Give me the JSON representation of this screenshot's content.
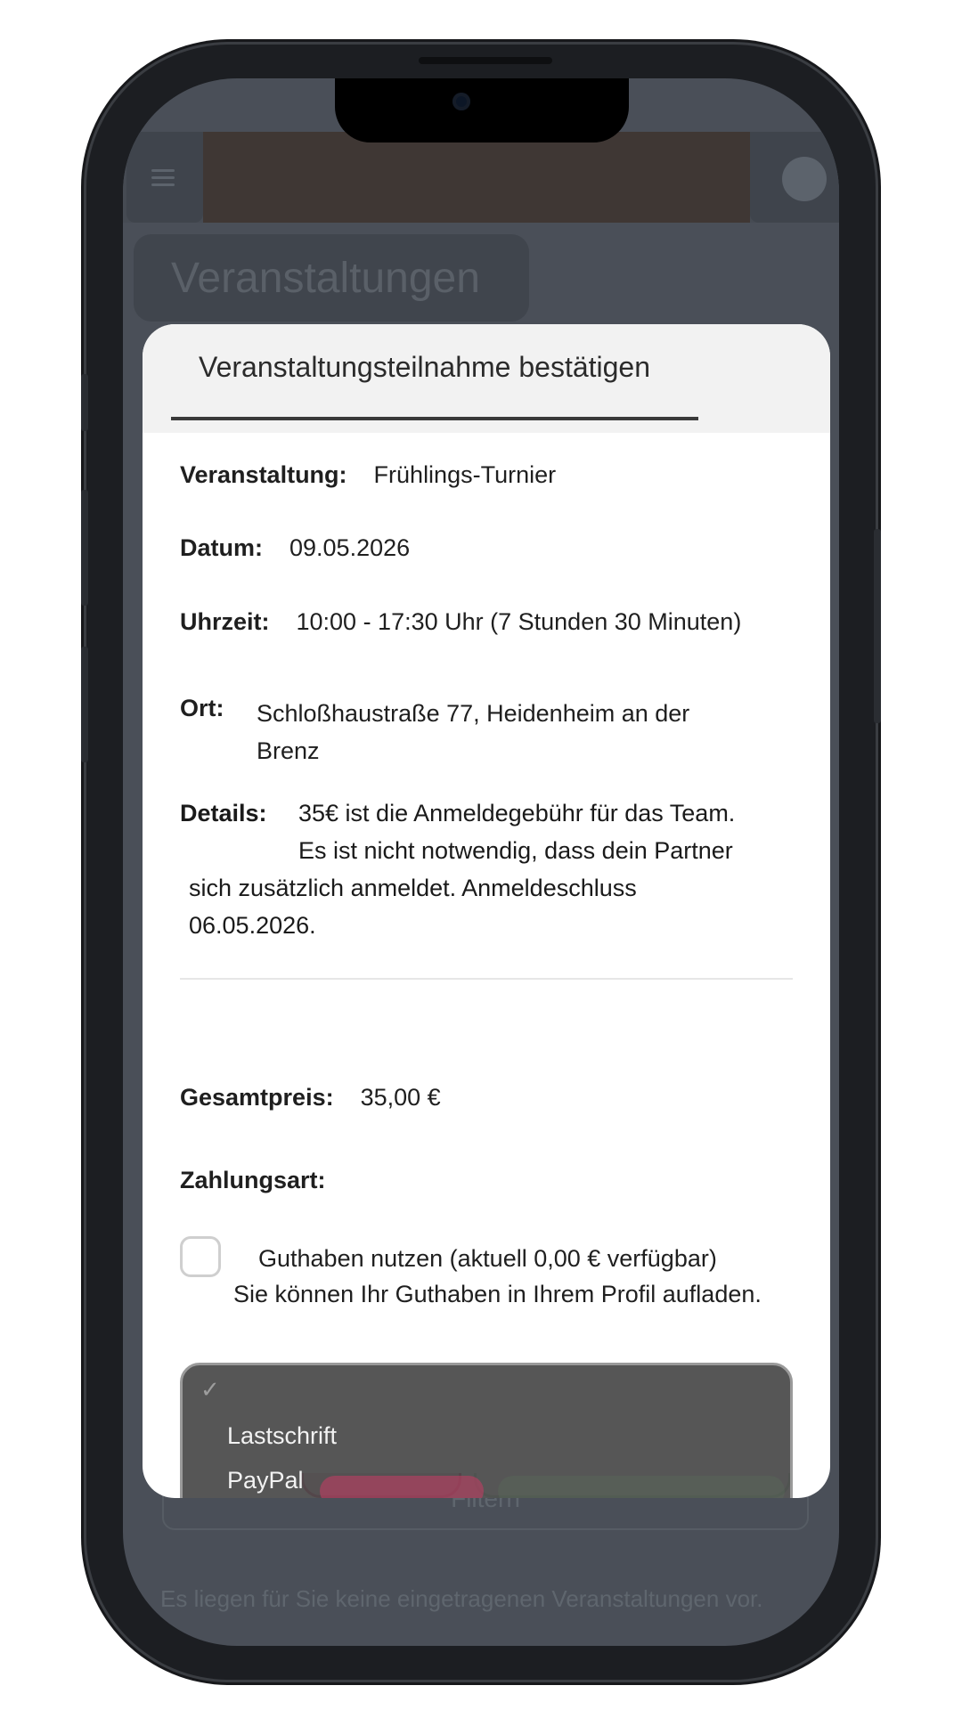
{
  "app": {
    "page_title": "Veranstaltungen",
    "filter_label": "Filtern",
    "empty_message": "Es liegen für Sie keine eingetragenen Veranstaltungen vor."
  },
  "modal": {
    "tab_title": "Veranstaltungsteilnahme bestätigen",
    "event": {
      "label": "Veranstaltung:",
      "value": "Frühlings-Turnier"
    },
    "date": {
      "label": "Datum:",
      "value": "09.05.2026"
    },
    "time": {
      "label": "Uhrzeit:",
      "value": "10:00 - 17:30 Uhr (7 Stunden 30 Minuten)"
    },
    "location": {
      "label": "Ort:",
      "value": "Schloßhaustraße 77, Heidenheim an der Brenz"
    },
    "details": {
      "label": "Details:",
      "line1": "35€ ist die Anmeldegebühr für das Team.",
      "line2": "Es ist nicht notwendig, dass dein Partner",
      "line3": "sich zusätzlich anmeldet. Anmeldeschluss",
      "line4": "06.05.2026."
    },
    "total": {
      "label": "Gesamtpreis:",
      "value": "35,00 €"
    },
    "payment": {
      "label": "Zahlungsart:",
      "credit_line1": "Guthaben nutzen (aktuell 0,00 € verfügbar)",
      "credit_line2": "Sie können Ihr Guthaben in Ihrem Profil aufladen.",
      "credit_checked": false
    },
    "payment_dropdown": {
      "selected_mark": "✓",
      "options": [
        "Lastschrift",
        "PayPal"
      ]
    }
  },
  "colors": {
    "accent_cancel": "#d6336c",
    "accent_confirm": "#a8d8ae",
    "overlay": "#4a4f58"
  },
  "icons": {
    "menu": "hamburger-icon",
    "user": "avatar",
    "selected": "check-icon"
  }
}
